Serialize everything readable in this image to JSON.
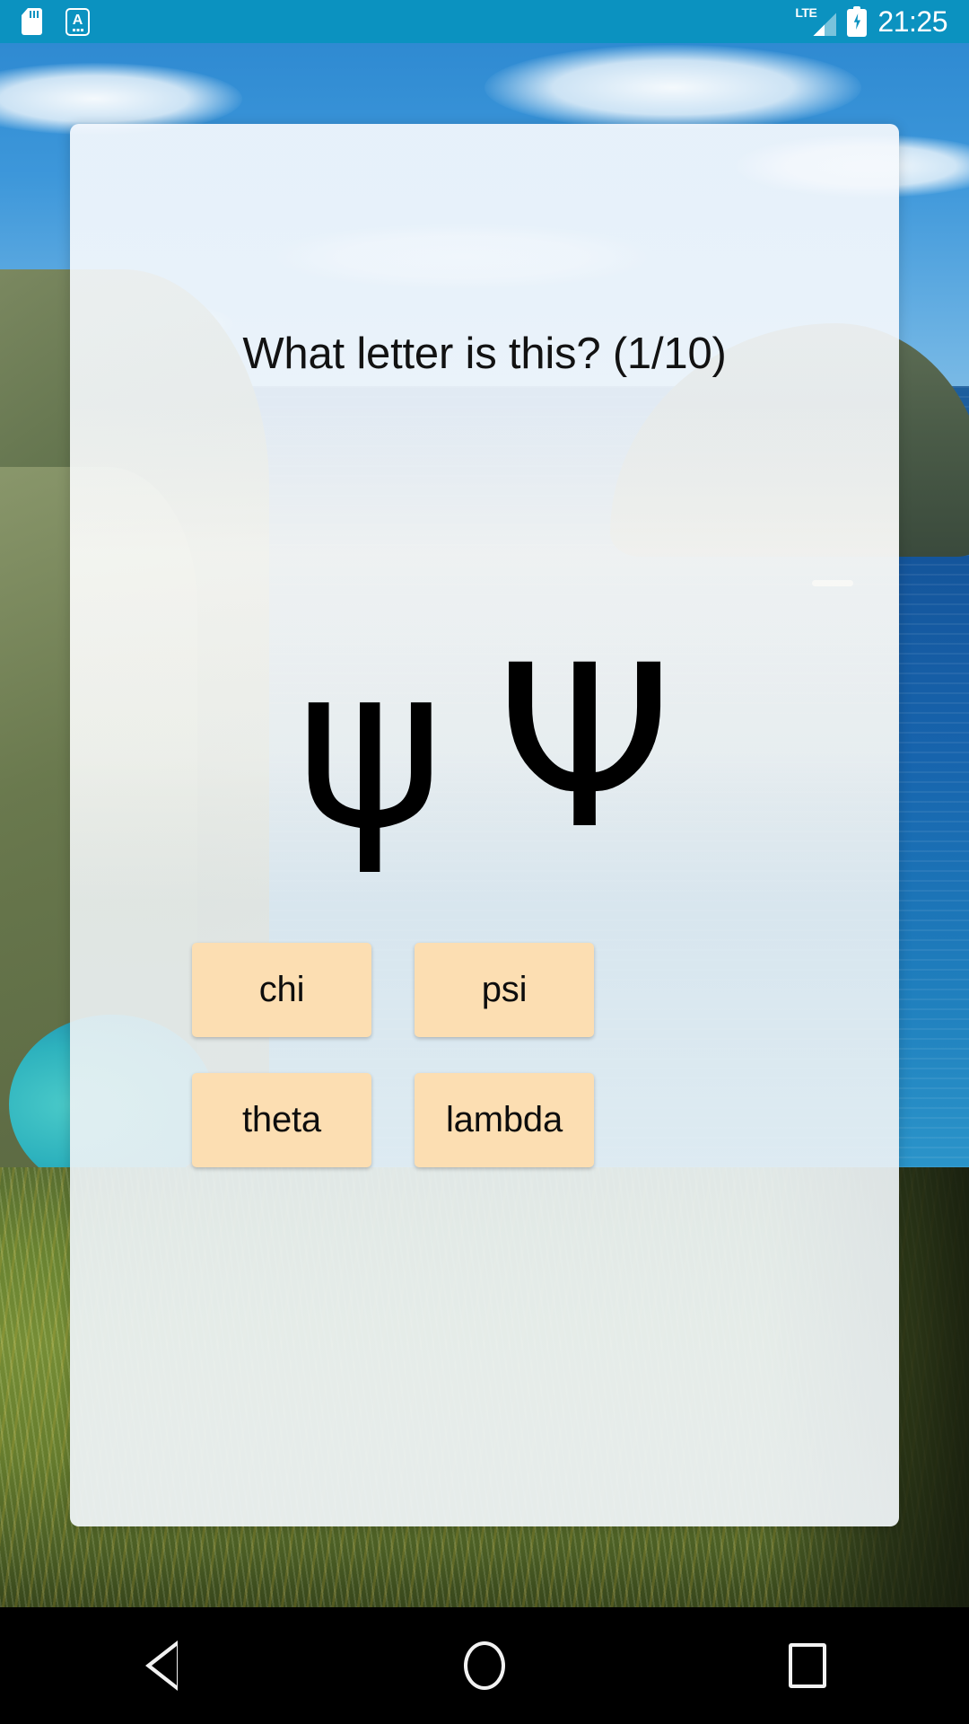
{
  "status_bar": {
    "background_color": "#0b92c0",
    "icons": [
      {
        "name": "sd-card-icon",
        "label": "SD card"
      },
      {
        "name": "font-a-icon",
        "label": "A"
      }
    ],
    "network": {
      "type": "LTE",
      "name": "lte-signal-icon"
    },
    "battery": {
      "name": "battery-charging-icon",
      "state": "charging"
    },
    "time": "21:25"
  },
  "quiz": {
    "title": "What letter is this? (1/10)",
    "question_number": 1,
    "question_total": 10,
    "letter_lowercase": "ψ",
    "letter_uppercase": "Ψ",
    "answers": [
      {
        "label": "chi"
      },
      {
        "label": "psi"
      },
      {
        "label": "theta"
      },
      {
        "label": "lambda"
      }
    ],
    "answer_button_color": "#fcdeb2",
    "card_color": "#f1f5f7"
  },
  "nav_bar": {
    "background_color": "#000000",
    "buttons": [
      {
        "name": "back-button",
        "label": "Back"
      },
      {
        "name": "home-button",
        "label": "Home"
      },
      {
        "name": "recents-button",
        "label": "Recents"
      }
    ]
  }
}
